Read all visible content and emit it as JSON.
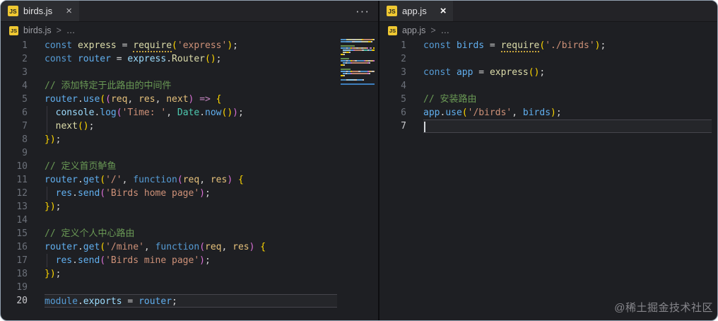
{
  "colors": {
    "kw": "#569CD6",
    "id": "#61AFEF",
    "dc": "#DCDCAA",
    "rq": "#DCDCAA",
    "pm": "#E5C07B",
    "tl": "#4EC9B0",
    "st": "#CE9178",
    "cm": "#6A9955",
    "pn": "#D4D4D4",
    "b1": "#FFD700",
    "b2": "#DA70D6",
    "ar": "#C586C0",
    "pr": "#9CDCFE",
    "accent_blue": "#3d7ebd",
    "js_icon_yellow": "#efc832"
  },
  "watermark": "@稀土掘金技术社区",
  "left_pane": {
    "tab": {
      "icon": "JS",
      "label": "birds.js",
      "close": "×"
    },
    "actions_label": "···",
    "breadcrumb": {
      "icon": "JS",
      "file": "birds.js",
      "sep": ">",
      "more": "…"
    },
    "editor": {
      "active_line": 20,
      "cursor_line": null,
      "lines": [
        {
          "n": 1,
          "tk": [
            [
              "const ",
              "kw"
            ],
            [
              "express",
              "dc"
            ],
            [
              " = ",
              "pn"
            ],
            [
              "require",
              "rq"
            ],
            [
              "(",
              "b1"
            ],
            [
              "'express'",
              "st"
            ],
            [
              ")",
              "b1"
            ],
            [
              ";",
              "pn"
            ]
          ]
        },
        {
          "n": 2,
          "tk": [
            [
              "const ",
              "kw"
            ],
            [
              "router",
              "id"
            ],
            [
              " = ",
              "pn"
            ],
            [
              "express",
              "pr"
            ],
            [
              ".",
              "pn"
            ],
            [
              "Router",
              "dc"
            ],
            [
              "(",
              "b1"
            ],
            [
              ")",
              "b1"
            ],
            [
              ";",
              "pn"
            ]
          ]
        },
        {
          "n": 3,
          "tk": []
        },
        {
          "n": 4,
          "tk": [
            [
              "// 添加特定于此路由的中间件",
              "cm"
            ]
          ]
        },
        {
          "n": 5,
          "tk": [
            [
              "router",
              "id"
            ],
            [
              ".",
              "pn"
            ],
            [
              "use",
              "id"
            ],
            [
              "(",
              "b1"
            ],
            [
              "(",
              "b2"
            ],
            [
              "req",
              "pm"
            ],
            [
              ", ",
              "pn"
            ],
            [
              "res",
              "pm"
            ],
            [
              ", ",
              "pn"
            ],
            [
              "next",
              "pm"
            ],
            [
              ")",
              "b2"
            ],
            [
              " ",
              "pn"
            ],
            [
              "=>",
              "ar"
            ],
            [
              " ",
              "pn"
            ],
            [
              "{",
              "b1"
            ]
          ]
        },
        {
          "n": 6,
          "g": true,
          "tk": [
            [
              "  ",
              "pn"
            ],
            [
              "console",
              "pr"
            ],
            [
              ".",
              "pn"
            ],
            [
              "log",
              "id"
            ],
            [
              "(",
              "b2"
            ],
            [
              "'Time: '",
              "st"
            ],
            [
              ", ",
              "pn"
            ],
            [
              "Date",
              "tl"
            ],
            [
              ".",
              "pn"
            ],
            [
              "now",
              "id"
            ],
            [
              "(",
              "b1"
            ],
            [
              ")",
              "b1"
            ],
            [
              ")",
              "b2"
            ],
            [
              ";",
              "pn"
            ]
          ]
        },
        {
          "n": 7,
          "g": true,
          "tk": [
            [
              "  ",
              "pn"
            ],
            [
              "next",
              "dc"
            ],
            [
              "(",
              "b1"
            ],
            [
              ")",
              "b1"
            ],
            [
              ";",
              "pn"
            ]
          ]
        },
        {
          "n": 8,
          "tk": [
            [
              "}",
              "b1"
            ],
            [
              ")",
              "b1"
            ],
            [
              ";",
              "pn"
            ]
          ]
        },
        {
          "n": 9,
          "tk": []
        },
        {
          "n": 10,
          "tk": [
            [
              "// 定义首页鲈鱼",
              "cm"
            ]
          ]
        },
        {
          "n": 11,
          "tk": [
            [
              "router",
              "id"
            ],
            [
              ".",
              "pn"
            ],
            [
              "get",
              "id"
            ],
            [
              "(",
              "b1"
            ],
            [
              "'/'",
              "st"
            ],
            [
              ", ",
              "pn"
            ],
            [
              "function",
              "kw"
            ],
            [
              "(",
              "b2"
            ],
            [
              "req",
              "pm"
            ],
            [
              ", ",
              "pn"
            ],
            [
              "res",
              "pm"
            ],
            [
              ")",
              "b2"
            ],
            [
              " ",
              "pn"
            ],
            [
              "{",
              "b1"
            ]
          ]
        },
        {
          "n": 12,
          "g": true,
          "tk": [
            [
              "  ",
              "pn"
            ],
            [
              "res",
              "id"
            ],
            [
              ".",
              "pn"
            ],
            [
              "send",
              "id"
            ],
            [
              "(",
              "b2"
            ],
            [
              "'Birds home page'",
              "st"
            ],
            [
              ")",
              "b2"
            ],
            [
              ";",
              "pn"
            ]
          ]
        },
        {
          "n": 13,
          "tk": [
            [
              "}",
              "b1"
            ],
            [
              ")",
              "b1"
            ],
            [
              ";",
              "pn"
            ]
          ]
        },
        {
          "n": 14,
          "tk": []
        },
        {
          "n": 15,
          "tk": [
            [
              "// 定义个人中心路由",
              "cm"
            ]
          ]
        },
        {
          "n": 16,
          "tk": [
            [
              "router",
              "id"
            ],
            [
              ".",
              "pn"
            ],
            [
              "get",
              "id"
            ],
            [
              "(",
              "b1"
            ],
            [
              "'/mine'",
              "st"
            ],
            [
              ", ",
              "pn"
            ],
            [
              "function",
              "kw"
            ],
            [
              "(",
              "b2"
            ],
            [
              "req",
              "pm"
            ],
            [
              ", ",
              "pn"
            ],
            [
              "res",
              "pm"
            ],
            [
              ")",
              "b2"
            ],
            [
              " ",
              "pn"
            ],
            [
              "{",
              "b1"
            ]
          ]
        },
        {
          "n": 17,
          "g": true,
          "tk": [
            [
              "  ",
              "pn"
            ],
            [
              "res",
              "id"
            ],
            [
              ".",
              "pn"
            ],
            [
              "send",
              "id"
            ],
            [
              "(",
              "b2"
            ],
            [
              "'Birds mine page'",
              "st"
            ],
            [
              ")",
              "b2"
            ],
            [
              ";",
              "pn"
            ]
          ]
        },
        {
          "n": 18,
          "tk": [
            [
              "}",
              "b1"
            ],
            [
              ")",
              "b1"
            ],
            [
              ";",
              "pn"
            ]
          ]
        },
        {
          "n": 19,
          "tk": []
        },
        {
          "n": 20,
          "tk": [
            [
              "module",
              "kw"
            ],
            [
              ".",
              "pn"
            ],
            [
              "exports",
              "pr"
            ],
            [
              " = ",
              "pn"
            ],
            [
              "router",
              "id"
            ],
            [
              ";",
              "pn"
            ]
          ]
        }
      ]
    }
  },
  "right_pane": {
    "tab": {
      "icon": "JS",
      "label": "app.js",
      "close": "×"
    },
    "breadcrumb": {
      "icon": "JS",
      "file": "app.js",
      "sep": ">",
      "more": "…"
    },
    "editor": {
      "active_line": 7,
      "cursor_line": 7,
      "lines": [
        {
          "n": 1,
          "tk": [
            [
              "const ",
              "kw"
            ],
            [
              "birds",
              "id"
            ],
            [
              " = ",
              "pn"
            ],
            [
              "require",
              "rq"
            ],
            [
              "(",
              "b1"
            ],
            [
              "'./birds'",
              "st"
            ],
            [
              ")",
              "b1"
            ],
            [
              ";",
              "pn"
            ]
          ]
        },
        {
          "n": 2,
          "tk": []
        },
        {
          "n": 3,
          "tk": [
            [
              "const ",
              "kw"
            ],
            [
              "app",
              "id"
            ],
            [
              " = ",
              "pn"
            ],
            [
              "express",
              "dc"
            ],
            [
              "(",
              "b1"
            ],
            [
              ")",
              "b1"
            ],
            [
              ";",
              "pn"
            ]
          ]
        },
        {
          "n": 4,
          "tk": []
        },
        {
          "n": 5,
          "tk": [
            [
              "// 安装路由",
              "cm"
            ]
          ]
        },
        {
          "n": 6,
          "tk": [
            [
              "app",
              "id"
            ],
            [
              ".",
              "pn"
            ],
            [
              "use",
              "id"
            ],
            [
              "(",
              "b1"
            ],
            [
              "'/birds'",
              "st"
            ],
            [
              ", ",
              "pn"
            ],
            [
              "birds",
              "id"
            ],
            [
              ")",
              "b1"
            ],
            [
              ";",
              "pn"
            ]
          ]
        },
        {
          "n": 7,
          "tk": []
        }
      ]
    }
  }
}
